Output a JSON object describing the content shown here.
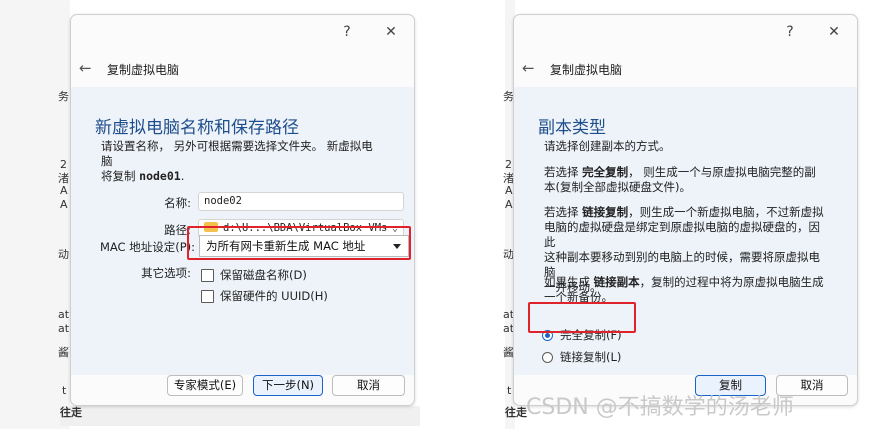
{
  "background_peek": {
    "left_chars": [
      "务",
      "2",
      "渚",
      "A",
      "A",
      "动",
      "at",
      "at",
      "酱",
      "t",
      "往走"
    ],
    "right_chars": [
      "务",
      "2",
      "渚",
      "A",
      "A",
      "动",
      "at",
      "at",
      "酱",
      "t",
      "往走"
    ]
  },
  "left_dialog": {
    "help": "?",
    "close": "✕",
    "nav_title": "复制虚拟电脑",
    "heading": "新虚拟电脑名称和保存路径",
    "desc_line1": "请设置名称， 另外可根据需要选择文件夹。 新虚拟电脑",
    "desc_line2_prefix": "将复制 ",
    "desc_line2_vm": "node01",
    "desc_line2_suffix": ".",
    "name_label": "名称:",
    "name_value": "node02",
    "path_label": "路径:",
    "path_value": "d:\\U...\\BDA\\VirtualBox VMs",
    "mac_label": "MAC 地址设定(P):",
    "mac_value": "为所有网卡重新生成 MAC 地址",
    "other_label": "其它选项:",
    "opt_keep_disk_names": "保留磁盘名称(D)",
    "opt_keep_hw_uuid": "保留硬件的 UUID(H)",
    "btn_expert": "专家模式(E)",
    "btn_next": "下一步(N)",
    "btn_cancel": "取消"
  },
  "right_dialog": {
    "help": "?",
    "close": "✕",
    "nav_title": "复制虚拟电脑",
    "heading": "副本类型",
    "intro": "请选择创建副本的方式。",
    "full_p1": "若选择 ",
    "full_p_bold": "完全复制",
    "full_p2": "， 则生成一个与原虚拟电脑完整的副",
    "full_p3": "本(复制全部虚拟硬盘文件)。",
    "linked_p1": "若选择 ",
    "linked_p_bold": "链接复制",
    "linked_p2": "，则生成一个新虚拟电脑，不过新虚拟",
    "linked_p3": "电脑的虚拟硬盘是绑定到原虚拟电脑的虚拟硬盘的，因此",
    "linked_p4": "这种副本要移动到别的电脑上的时候，需要将原虚拟电脑",
    "linked_p5": "一并移动。",
    "gen_p1": "如果生成 ",
    "gen_p_bold": "链接副本",
    "gen_p2": "，复制的过程中将为原虚拟电脑生成",
    "gen_p3": "一个新备份。",
    "radio_full": "完全复制(F)",
    "radio_linked": "链接复制(L)",
    "selected": "full",
    "btn_clone": "复制",
    "btn_cancel": "取消"
  },
  "watermark": "CSDN @不搞数学的汤老师",
  "colors": {
    "accent": "#1a64c8",
    "highlight_box": "#e0232b",
    "heading": "#1f4e8c"
  }
}
